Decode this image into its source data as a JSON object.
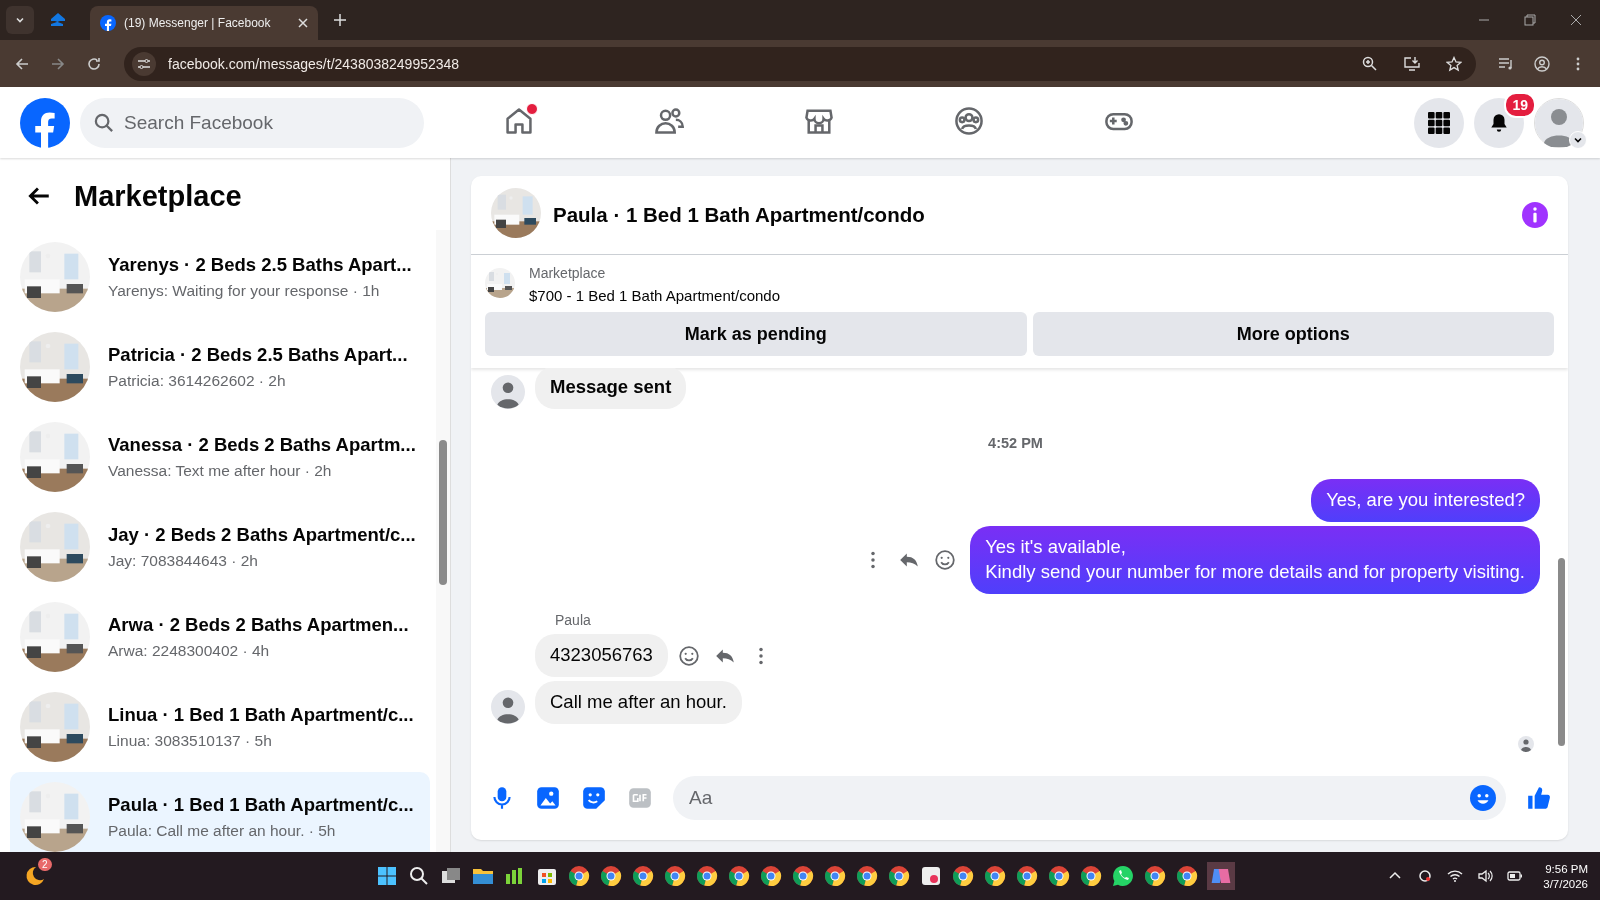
{
  "browser": {
    "tabs": [
      {
        "title": "(19) Messenger | Facebook",
        "selected": true
      }
    ],
    "url": "facebook.com/messages/t/2438038249952348"
  },
  "header": {
    "search_placeholder": "Search Facebook",
    "nav": [
      {
        "selected": false,
        "dot": true
      },
      {
        "selected": false,
        "dot": false
      },
      {
        "selected": false,
        "dot": false
      },
      {
        "selected": false,
        "dot": false
      },
      {
        "selected": false,
        "dot": false
      }
    ],
    "notification_count": "19"
  },
  "sidebar": {
    "title": "Marketplace",
    "conversations": [
      {
        "title": "Yarenys · 2 Beds 2.5 Baths Apart...",
        "preview": "Yarenys: Waiting for your response · 1h",
        "selected": false
      },
      {
        "title": "Patricia · 2 Beds 2.5 Baths Apart...",
        "preview": "Patricia: 3614262602 · 2h",
        "selected": false
      },
      {
        "title": "Vanessa · 2 Beds 2 Baths Apartm...",
        "preview": "Vanessa: Text me after hour · 2h",
        "selected": false
      },
      {
        "title": "Jay · 2 Beds 2 Baths Apartment/c...",
        "preview": "Jay: 7083844643 · 2h",
        "selected": false
      },
      {
        "title": "Arwa · 2 Beds 2 Baths Apartmen...",
        "preview": "Arwa: 2248300402 · 4h",
        "selected": false
      },
      {
        "title": "Linua · 1 Bed 1 Bath Apartment/c...",
        "preview": "Linua: 3083510137 · 5h",
        "selected": false
      },
      {
        "title": "Paula · 1 Bed 1 Bath Apartment/c...",
        "preview": "Paula: Call me after an hour. · 5h",
        "selected": true
      }
    ]
  },
  "chat": {
    "title": "Paula · 1 Bed 1 Bath Apartment/condo",
    "listing": {
      "label": "Marketplace",
      "title": "$700 - 1 Bed 1 Bath Apartment/condo"
    },
    "buttons": [
      "Mark as pending",
      "More options"
    ],
    "messages": [
      {
        "kind": "received",
        "text": "Message sent",
        "bold": true,
        "avatar": true,
        "actions": false
      },
      {
        "kind": "timestamp",
        "text": "4:52 PM"
      },
      {
        "kind": "sent",
        "text": "Yes, are you interested?",
        "actions": false
      },
      {
        "kind": "sent",
        "text": "Yes it's available,\nKindly send your number for more details and for property visiting.",
        "actions": true
      },
      {
        "kind": "sender",
        "text": "Paula"
      },
      {
        "kind": "received",
        "text": "4323056763",
        "bold": false,
        "avatar": false,
        "actions": true
      },
      {
        "kind": "received",
        "text": "Call me after an hour.",
        "bold": false,
        "avatar": true,
        "actions": false
      },
      {
        "kind": "seen"
      }
    ],
    "composer_placeholder": "Aa"
  },
  "taskbar": {
    "badge": "2",
    "time": "9:56 PM",
    "date": "3/7/2026"
  }
}
